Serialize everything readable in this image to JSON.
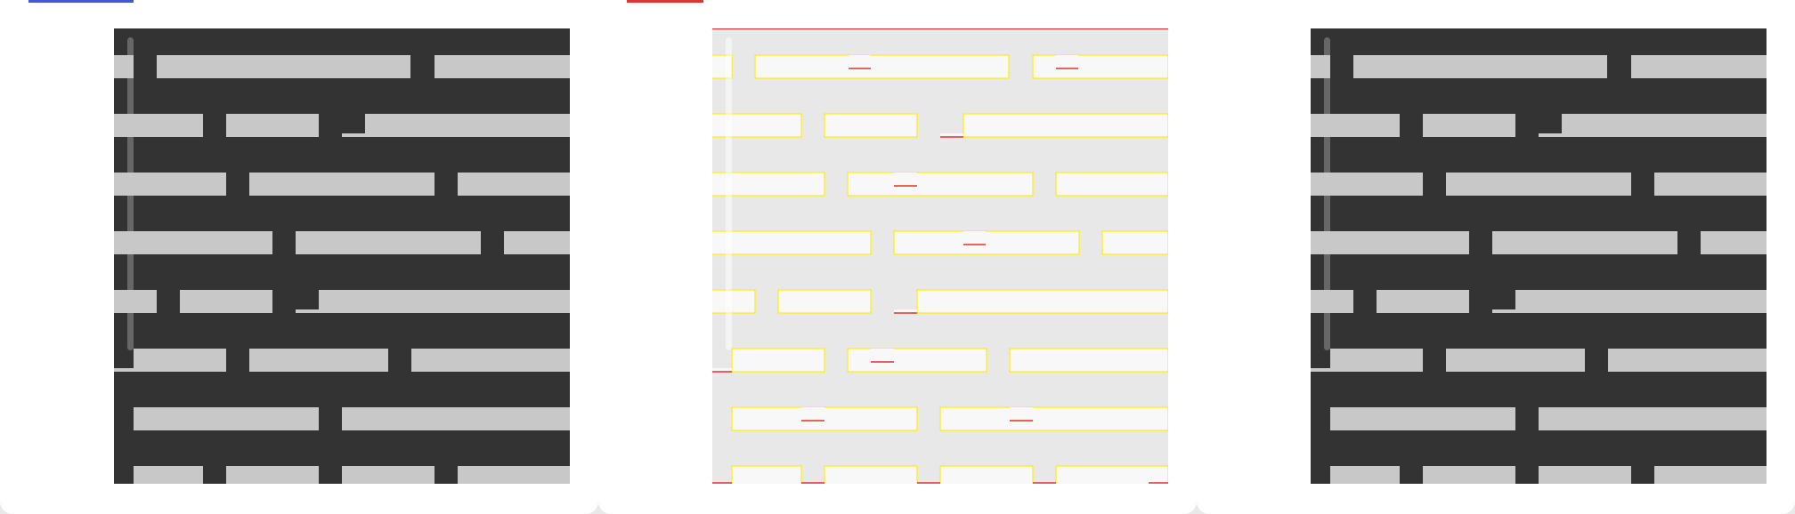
{
  "panels": [
    {
      "id": "dark-left",
      "tab_accent": "#4558c8",
      "canvas": {
        "background": "#333333",
        "bar": "#c8c8c8",
        "stroke": "none",
        "notch_line": "none",
        "rail": "rgba(200,200,200,0.35)",
        "grip": "#c8c8c8"
      }
    },
    {
      "id": "light-outlined",
      "tab_accent": "#e0332b",
      "canvas": {
        "background": "#e8e8e8",
        "bar": "#f8f8f8",
        "stroke": "#ffee00",
        "notch_line": "#e0332b",
        "rail": "rgba(255,255,255,0.5)",
        "grip": "none"
      }
    },
    {
      "id": "dark-right",
      "tab_accent": "",
      "canvas": {
        "background": "#333333",
        "bar": "#c8c8c8",
        "stroke": "none",
        "notch_line": "none",
        "rail": "rgba(200,200,200,0.35)",
        "grip": "#c8c8c8"
      }
    }
  ]
}
